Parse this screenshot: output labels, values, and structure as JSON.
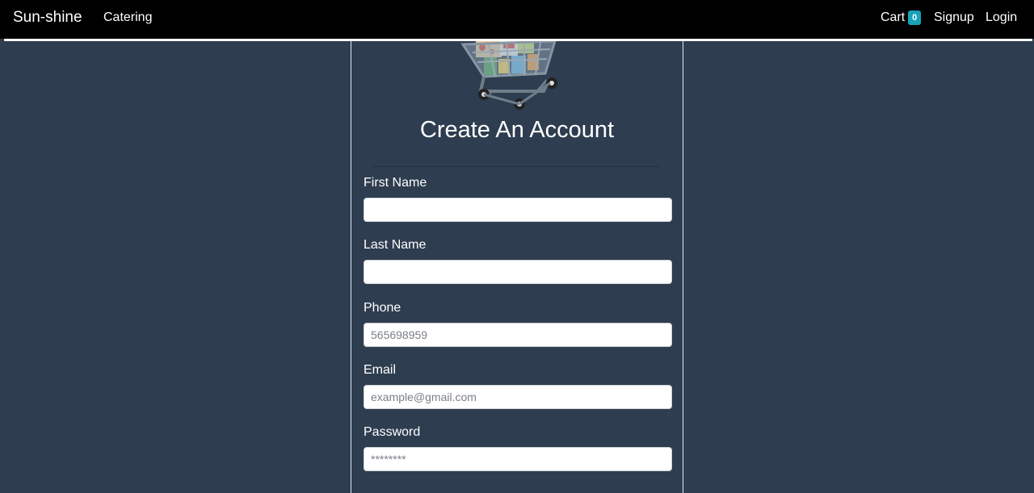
{
  "navbar": {
    "brand": "Sun-shine",
    "links": {
      "catering": "Catering",
      "cart": "Cart",
      "signup": "Signup",
      "login": "Login"
    },
    "cart_count": "0"
  },
  "form": {
    "illustration_icon": "shopping-cart-icon",
    "title": "Create An Account",
    "fields": {
      "first_name": {
        "label": "First Name",
        "value": "",
        "placeholder": ""
      },
      "last_name": {
        "label": "Last Name",
        "value": "",
        "placeholder": ""
      },
      "phone": {
        "label": "Phone",
        "value": "",
        "placeholder": "565698959"
      },
      "email": {
        "label": "Email",
        "value": "",
        "placeholder": "example@gmail.com"
      },
      "password": {
        "label": "Password",
        "value": "",
        "placeholder": "********"
      }
    }
  },
  "colors": {
    "background": "#2e3d50",
    "navbar": "#000000",
    "badge": "#17a2b8"
  }
}
